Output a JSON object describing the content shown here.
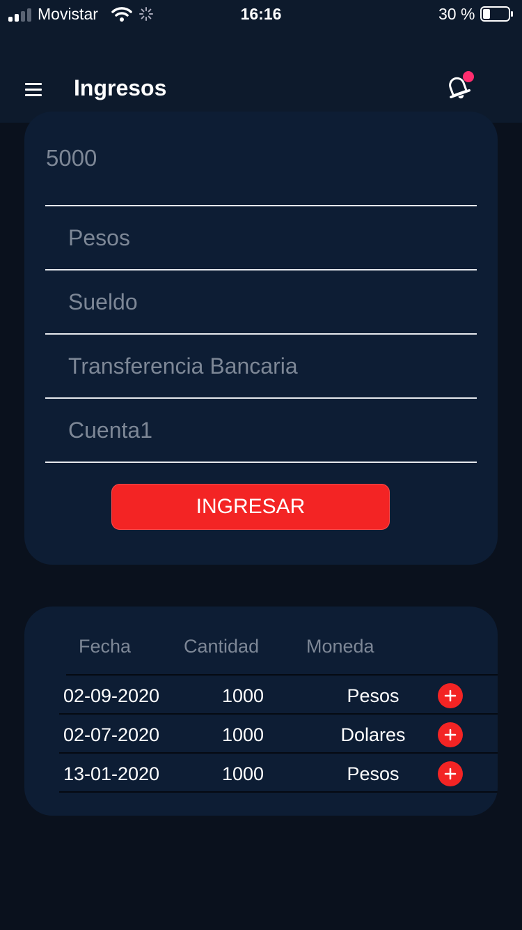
{
  "status_bar": {
    "carrier": "Movistar",
    "time": "16:16",
    "battery": "30 %"
  },
  "header": {
    "title": "Ingresos"
  },
  "form": {
    "amount": "5000",
    "currency": "Pesos",
    "category": "Sueldo",
    "method": "Transferencia Bancaria",
    "account": "Cuenta1",
    "submit_label": "INGRESAR"
  },
  "table": {
    "headers": [
      "Fecha",
      "Cantidad",
      "Moneda"
    ],
    "rows": [
      {
        "fecha": "02-09-2020",
        "cantidad": "1000",
        "moneda": "Pesos"
      },
      {
        "fecha": "02-07-2020",
        "cantidad": "1000",
        "moneda": "Dolares"
      },
      {
        "fecha": "13-01-2020",
        "cantidad": "1000",
        "moneda": "Pesos"
      }
    ]
  },
  "colors": {
    "accent": "#f32424",
    "card": "#0d1d34",
    "background": "#0a111d",
    "notification_dot": "#ff2d6f"
  },
  "icons": [
    "signal-icon",
    "wifi-icon",
    "spinner-icon",
    "battery-icon",
    "menu-icon",
    "bell-icon",
    "plus-icon"
  ]
}
